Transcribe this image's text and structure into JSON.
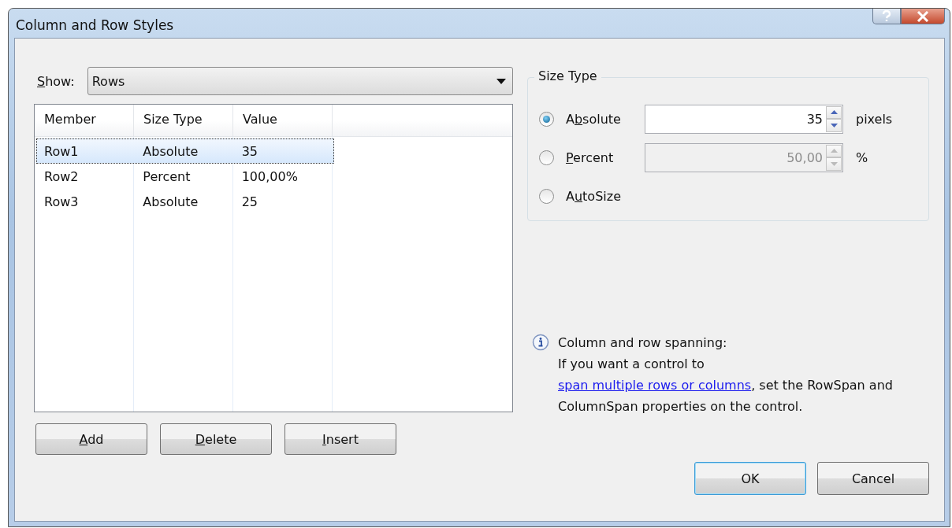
{
  "window": {
    "title": "Column and Row Styles"
  },
  "show": {
    "label_parts": {
      "key": "S",
      "after": "how:"
    },
    "value": "Rows"
  },
  "table": {
    "columns": [
      "Member",
      "Size Type",
      "Value"
    ],
    "rows": [
      {
        "cells": [
          "Row1",
          "Absolute",
          "35"
        ],
        "selected": true
      },
      {
        "cells": [
          "Row2",
          "Percent",
          "100,00%"
        ],
        "selected": false
      },
      {
        "cells": [
          "Row3",
          "Absolute",
          "25"
        ],
        "selected": false
      }
    ]
  },
  "list_buttons": [
    {
      "label_parts": {
        "key": "A",
        "after": "dd"
      }
    },
    {
      "label_parts": {
        "key": "D",
        "after": "elete"
      }
    },
    {
      "label_parts": {
        "key": "I",
        "after": "nsert"
      }
    }
  ],
  "size_type": {
    "title": "Size Type",
    "options": [
      {
        "kind": "spin",
        "label_parts": {
          "before": "A",
          "key": "b",
          "after": "solute"
        },
        "selected": true,
        "value": "35",
        "unit": "pixels",
        "disabled": false
      },
      {
        "kind": "spin",
        "label_parts": {
          "key": "P",
          "after": "ercent"
        },
        "selected": false,
        "value": "50,00",
        "unit": "%",
        "disabled": true
      },
      {
        "kind": "plain",
        "label_parts": {
          "before": "A",
          "key": "u",
          "after": "toSize"
        },
        "selected": false
      }
    ]
  },
  "info": {
    "heading": "Column and row spanning:",
    "text_before": "If you want a control to ",
    "link": "span multiple rows or columns",
    "text_after": ", set the RowSpan and ColumnSpan properties on the control."
  },
  "dialog_buttons": [
    {
      "label": "OK",
      "default": true
    },
    {
      "label": "Cancel",
      "default": false
    }
  ]
}
